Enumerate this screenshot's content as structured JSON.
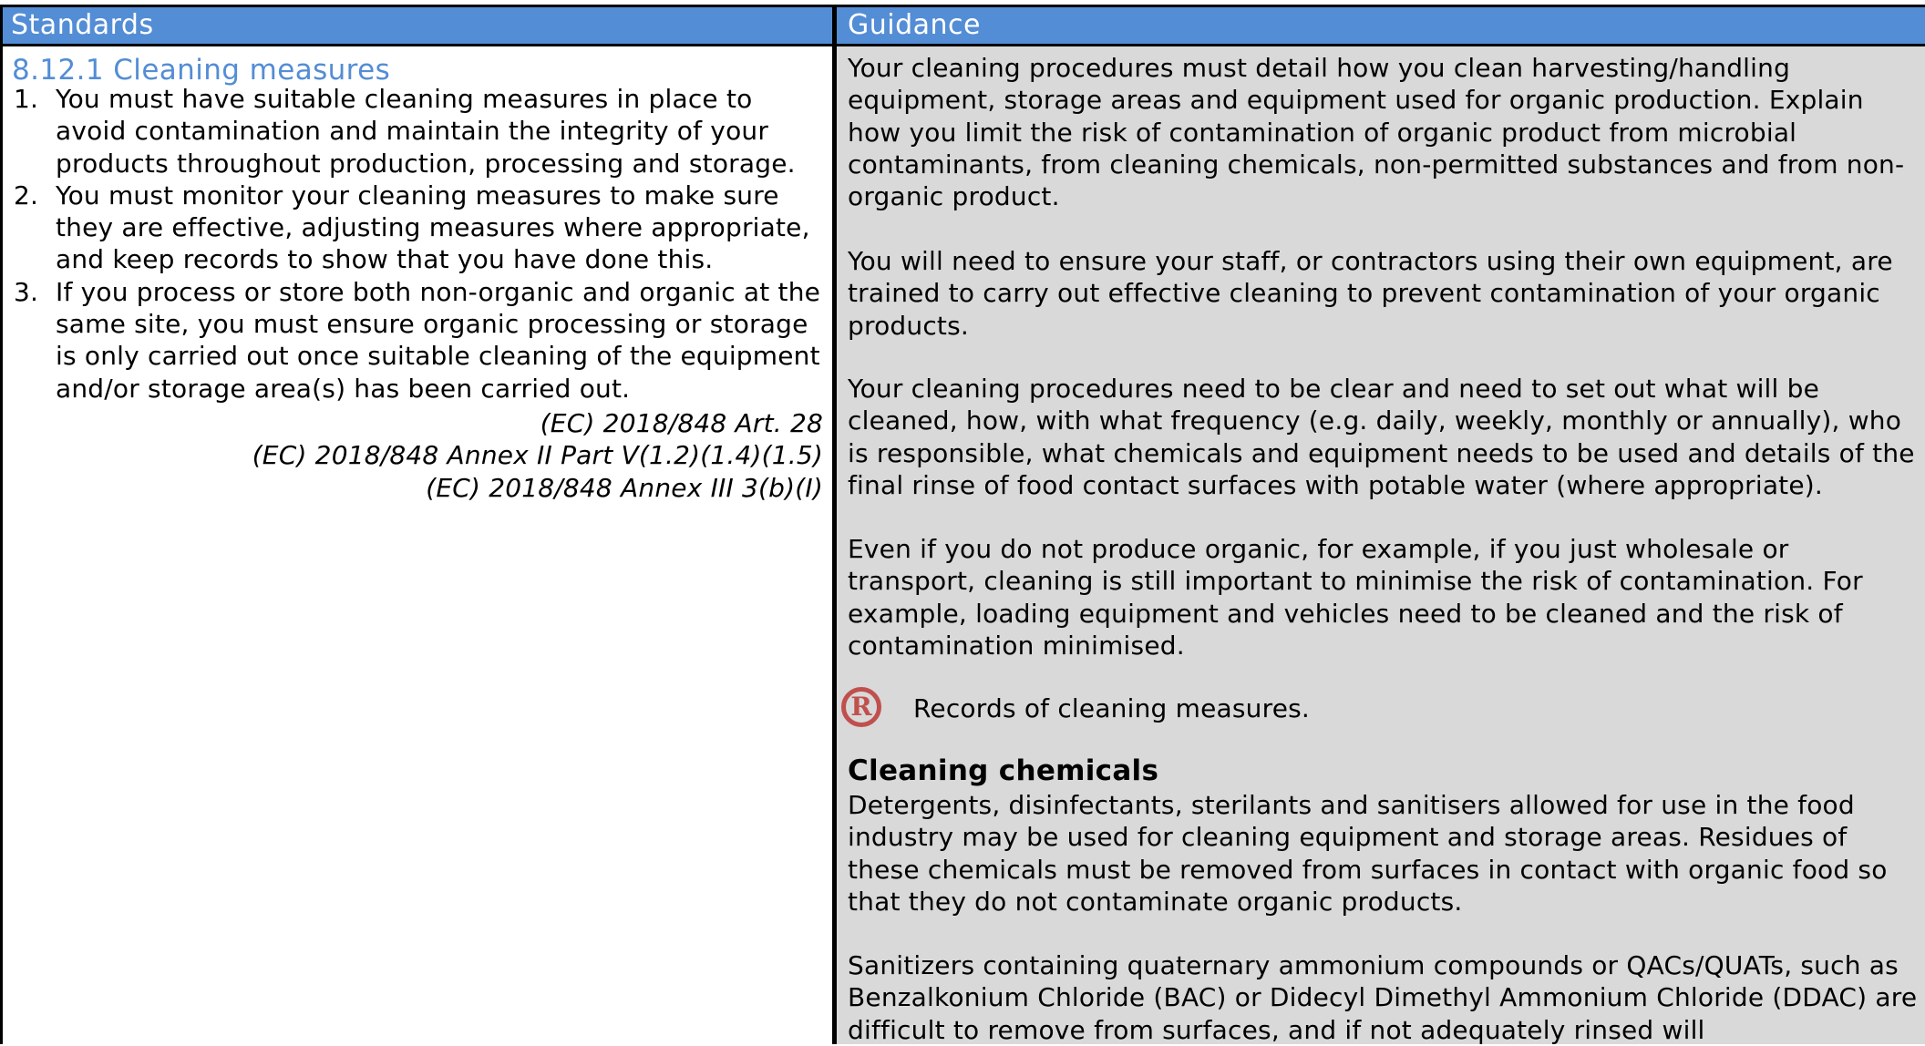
{
  "header": {
    "standards": "Standards",
    "guidance": "Guidance"
  },
  "standards": {
    "section_title": "8.12.1 Cleaning measures",
    "items": [
      {
        "num": "1.",
        "text": "You must have suitable cleaning measures in place to avoid contamination and maintain the integrity of your products throughout production, processing and storage."
      },
      {
        "num": "2.",
        "text": "You must monitor your cleaning measures to make sure they are effective, adjusting measures where appropriate, and keep records to show that you have done this."
      },
      {
        "num": "3.",
        "text": "If you process or store both non-organic and organic at the same site, you must ensure organic processing or storage is only carried out once suitable cleaning of the equipment and/or storage area(s) has been carried out."
      }
    ],
    "references": [
      "(EC) 2018/848 Art. 28",
      "(EC) 2018/848 Annex II Part V(1.2)(1.4)(1.5)",
      "(EC) 2018/848 Annex III 3(b)(I)"
    ]
  },
  "guidance": {
    "paragraphs": [
      "Your cleaning procedures must detail how you clean harvesting/handling equipment, storage areas and equipment used for organic production. Explain how you limit the risk of contamination of organic product from microbial contaminants, from cleaning chemicals, non-permitted substances and from non-organic product.",
      "You will need to ensure your staff, or contractors using their own equipment, are trained to carry out effective cleaning to prevent contamination of your organic products.",
      "Your cleaning procedures need to be clear and need to set out what will be cleaned, how, with what frequency (e.g. daily, weekly, monthly or annually), who is responsible, what chemicals and equipment needs to be used and details of the final rinse of food contact surfaces with potable water (where appropriate).",
      "Even if you do not produce organic, for example, if you just wholesale or transport, cleaning is still important to minimise the risk of contamination. For example, loading equipment and vehicles need to be cleaned and the risk of contamination minimised."
    ],
    "record_badge": "R",
    "record_text": "Records of cleaning measures.",
    "chemicals_heading": "Cleaning chemicals",
    "chemicals_paragraphs": [
      "Detergents, disinfectants, sterilants and sanitisers allowed for use in the food industry may be used for cleaning equipment and storage areas. Residues of these chemicals must be removed from surfaces in contact with organic food so that they do not contaminate organic products.",
      "Sanitizers containing quaternary ammonium compounds or QACs/QUATs, such as Benzalkonium Chloride (BAC) or Didecyl Dimethyl Ammonium Chloride (DDAC) are difficult to remove from surfaces, and if not adequately rinsed will"
    ],
    "colors": {
      "header_bg": "#538dd5",
      "guidance_bg": "#d9d9d9",
      "record_icon": "#c0504d"
    }
  }
}
